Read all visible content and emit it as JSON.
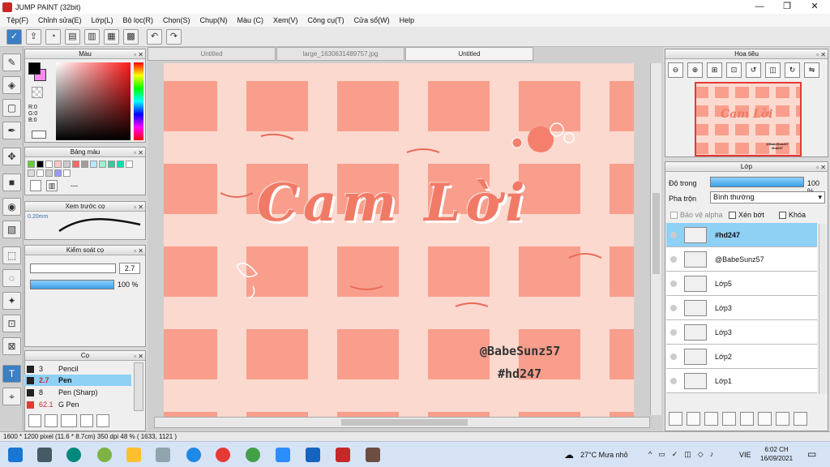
{
  "window": {
    "title": "JUMP PAINT (32bit)",
    "controls": [
      "—",
      "❐",
      "✕"
    ]
  },
  "menu": [
    "Tệp(F)",
    "Chỉnh sửa(E)",
    "Lớp(L)",
    "Bộ lọc(R)",
    "Chọn(S)",
    "Chụp(N)",
    "Màu (C)",
    "Xem(V)",
    "Công cụ(T)",
    "Cửa sổ(W)",
    "Help"
  ],
  "panels": {
    "color": {
      "title": "Màu",
      "r": "R:0",
      "g": "G:0",
      "b": "B:0",
      "fg": "#000000",
      "bg": "#ff88ee"
    },
    "palette": {
      "title": "Bảng màu",
      "swatches": [
        "#66cc33",
        "#000000",
        "#ffffff",
        "#ffc8c8",
        "#cccccc",
        "#ff6666",
        "#a0a0a0",
        "#b8e8ff",
        "#a0f0d0",
        "#33cc99",
        "#00e0b0",
        "#ffffff",
        "#dddddd",
        "#ffffff",
        "#cccccc",
        "#9999ff",
        "#ffffff"
      ],
      "status": "---"
    },
    "brush_preview": {
      "title": "Xem trước cọ",
      "size": "0.20mm"
    },
    "brush_control": {
      "title": "Kiểm soát cọ",
      "size_value": "2.7",
      "opacity_value": "100 %",
      "opacity": 1.0
    },
    "brushes": {
      "title": "Cọ",
      "items": [
        {
          "size": "3",
          "name": "Pencil",
          "color": "#222222"
        },
        {
          "size": "2.7",
          "name": "Pen",
          "color": "#222222"
        },
        {
          "size": "8",
          "name": "Pen (Sharp)",
          "color": "#222222"
        },
        {
          "size": "62.1",
          "name": "G Pen",
          "color": "#e53935"
        }
      ]
    },
    "navigator": {
      "title": "Hoa tiêu"
    },
    "layers": {
      "title": "Lớp",
      "opacity_label": "Độ trong",
      "opacity_value": "100 %",
      "opacity": 1.0,
      "blend_label": "Pha trộn",
      "blend_value": "Bình thường",
      "protect_alpha": "Bảo vệ alpha",
      "clipping": "Xén bớt",
      "lock": "Khóa",
      "items": [
        {
          "name": "#hd247",
          "selected": true
        },
        {
          "name": "@BabeSunz57",
          "selected": false
        },
        {
          "name": "Lớp5",
          "selected": false
        },
        {
          "name": "Lớp3",
          "selected": false
        },
        {
          "name": "Lớp3",
          "selected": false
        },
        {
          "name": "Lớp2",
          "selected": false
        },
        {
          "name": "Lớp1",
          "selected": false
        }
      ]
    }
  },
  "tabs": [
    "Untitled",
    "large_1630631489757.jpg",
    "Untitled"
  ],
  "artwork": {
    "main_text": "Cam Lời",
    "credit": "@BabeSunz57",
    "hashtag": "#hd247",
    "thumb_credit": "@BabeSunz57",
    "thumb_hashtag": "#hd247",
    "bg": "#fbd9cf",
    "cell": "#f99e8c",
    "text_color": "#f07a66"
  },
  "status": "1600 * 1200 pixel   (11.6 * 8.7cm)  350 dpi   48 %   ( 1633, 1121 )",
  "taskbar": {
    "weather": "27°C  Mưa nhỏ",
    "lang": "VIE",
    "time": "6:02 CH",
    "date": "16/09/2021"
  }
}
